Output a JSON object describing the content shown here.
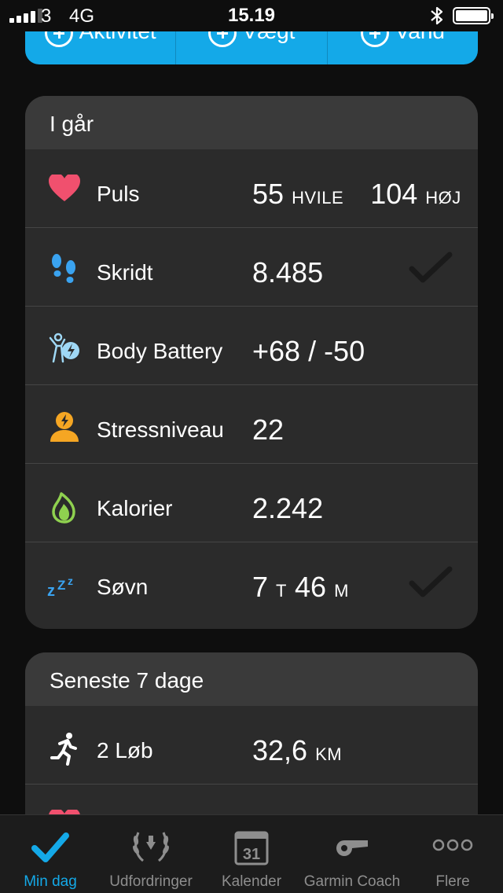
{
  "status_bar": {
    "carrier": "3",
    "network": "4G",
    "time": "15.19",
    "signal_bars": 4
  },
  "quick_add": [
    {
      "label": "Aktivitet"
    },
    {
      "label": "Vægt"
    },
    {
      "label": "Vand"
    }
  ],
  "yesterday": {
    "title": "I går",
    "pulse": {
      "label": "Puls",
      "rest_value": "55",
      "rest_unit": "HVILE",
      "high_value": "104",
      "high_unit": "HØJ"
    },
    "steps": {
      "label": "Skridt",
      "value": "8.485",
      "goal_met": true
    },
    "body_battery": {
      "label": "Body Battery",
      "value": "+68 / -50"
    },
    "stress": {
      "label": "Stressniveau",
      "value": "22"
    },
    "calories": {
      "label": "Kalorier",
      "value": "2.242"
    },
    "sleep": {
      "label": "Søvn",
      "hours": "7",
      "hours_unit": "T",
      "minutes": "46",
      "minutes_unit": "M",
      "goal_met": true
    }
  },
  "last7": {
    "title": "Seneste 7 dage",
    "runs": {
      "label": "2 Løb",
      "value": "32,6",
      "unit": "KM"
    }
  },
  "tabs": [
    {
      "label": "Min dag",
      "icon": "checkmark-icon",
      "active": true
    },
    {
      "label": "Udfordringer",
      "icon": "laurel-icon",
      "active": false
    },
    {
      "label": "Kalender",
      "icon": "calendar-icon",
      "active": false,
      "date": "31"
    },
    {
      "label": "Garmin Coach",
      "icon": "whistle-icon",
      "active": false
    },
    {
      "label": "Flere",
      "icon": "more-icon",
      "active": false
    }
  ],
  "colors": {
    "accent": "#14a9e8",
    "heart": "#f0506e",
    "steps": "#3aa3f0",
    "stress": "#f5a623",
    "calories": "#8fd14f",
    "sleep": "#3aa3f0"
  }
}
